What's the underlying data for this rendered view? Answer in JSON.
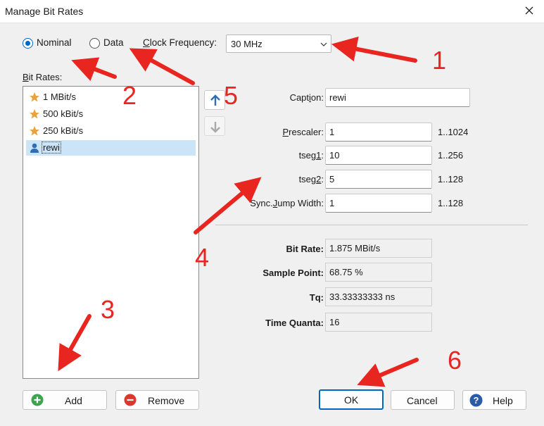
{
  "window": {
    "title": "Manage Bit Rates"
  },
  "mode": {
    "nominal_label": "Nominal",
    "data_label": "Data",
    "selected": "Nominal"
  },
  "clock": {
    "label_prefix": "C",
    "label_rest": "lock Frequency:",
    "value": "30 MHz"
  },
  "bitrates": {
    "label_prefix": "B",
    "label_rest": "it Rates:",
    "items": [
      {
        "label": "1 MBit/s",
        "icon": "star-icon"
      },
      {
        "label": "500 kBit/s",
        "icon": "star-icon"
      },
      {
        "label": "250 kBit/s",
        "icon": "star-icon"
      },
      {
        "label": "rewi",
        "icon": "user-icon",
        "selected": true
      }
    ]
  },
  "form": {
    "caption": {
      "a": "Capt",
      "u": "i",
      "b": "on:",
      "value": "rewi"
    },
    "prescaler": {
      "a": "",
      "u": "P",
      "b": "rescaler:",
      "value": "1",
      "range": "1..1024"
    },
    "tseg1": {
      "a": "tseg",
      "u": "1",
      "b": ":",
      "value": "10",
      "range": "1..256"
    },
    "tseg2": {
      "a": "tseg",
      "u": "2",
      "b": ":",
      "value": "5",
      "range": "1..128"
    },
    "sjw": {
      "a": "Sync.",
      "u": "J",
      "b": "ump Width:",
      "value": "1",
      "range": "1..128"
    }
  },
  "results": {
    "bit_rate": {
      "label": "Bit Rate:",
      "value": "1.875 MBit/s"
    },
    "sample_point": {
      "label": "Sample Point:",
      "value": "68.75 %"
    },
    "tq": {
      "label": "Tq:",
      "value": "33.33333333 ns"
    },
    "time_quanta": {
      "label": "Time Quanta:",
      "value": "16"
    }
  },
  "buttons": {
    "add": "Add",
    "remove": "Remove",
    "ok": "OK",
    "cancel": "Cancel",
    "help": "Help"
  },
  "annotations": [
    "1",
    "2",
    "3",
    "4",
    "5",
    "6"
  ],
  "colors": {
    "accent": "#0067c0",
    "annotation": "#e8251f",
    "selection": "#cce4f7",
    "star": "#e8a33c"
  }
}
